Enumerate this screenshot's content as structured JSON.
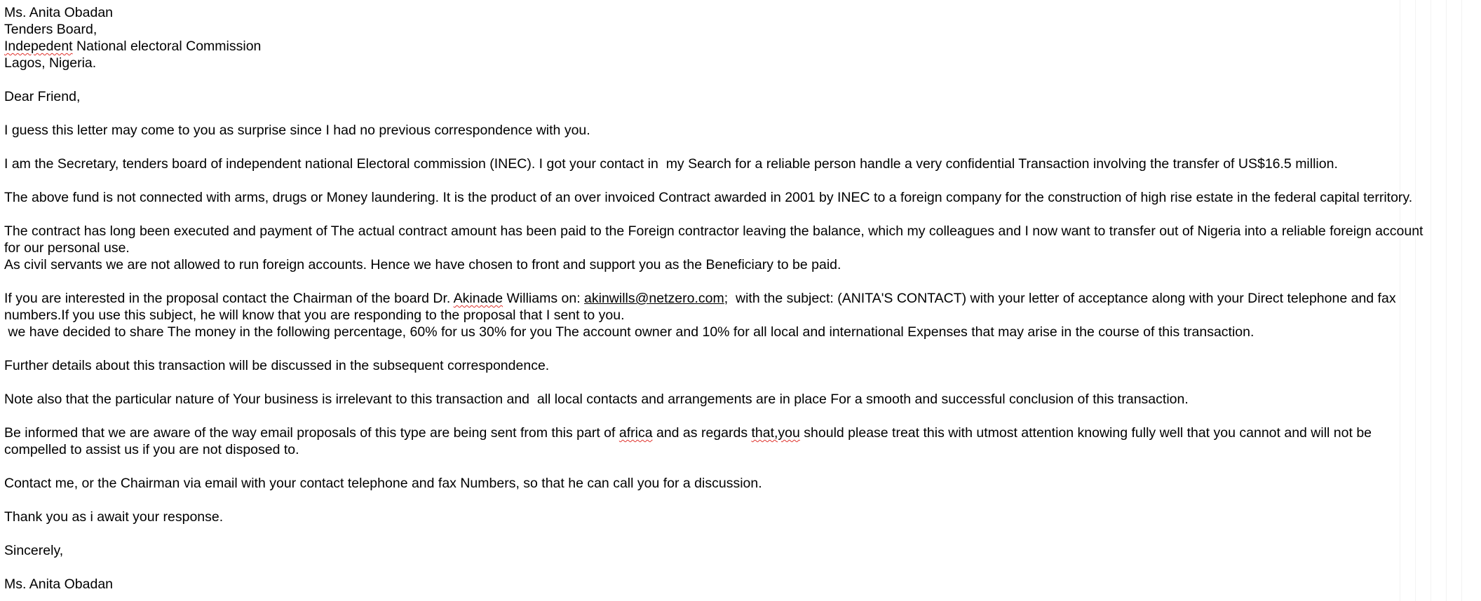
{
  "letter": {
    "address": {
      "name": "Ms. Anita Obadan",
      "board": "Tenders Board,",
      "org_misspelled": "Indepedent",
      "org_rest": " National electoral Commission",
      "city": "Lagos, Nigeria."
    },
    "greeting": "Dear Friend,",
    "p1": "I guess this letter may come to you as surprise since I had no previous correspondence with you.",
    "p2": "I am the Secretary, tenders board of independent national Electoral commission (INEC). I got your contact in  my Search for a reliable person handle a very confidential Transaction involving the transfer of US$16.5 million.",
    "p3": "The above fund is not connected with arms, drugs or Money laundering. It is the product of an over invoiced Contract awarded in 2001 by INEC to a foreign company for the construction of high rise estate in the federal capital territory.",
    "p4_line1": "The contract has long been executed and payment of The actual contract amount has been paid to the Foreign contractor leaving the balance, which my colleagues and I now want to transfer out of Nigeria into a reliable foreign account",
    "p4_line2": "for our personal use.",
    "p4_line3": "As civil servants we are not allowed to run foreign accounts. Hence we have chosen to front and support you as the Beneficiary to be paid.",
    "p5": {
      "before_name": "If you are interested in the proposal contact the Chairman of the board Dr. ",
      "name_misspelled": "Akinade",
      "after_name": " Williams on: ",
      "email": "akinwills@netzero.com",
      "after_email": ";  with the subject: (ANITA'S CONTACT) with your letter of acceptance along with your Direct telephone and fax",
      "line2": "numbers.If you use this subject, he will know that you are responding to the proposal that I sent to you.",
      "line3": " we have decided to share The money in the following percentage, 60% for us 30% for you The account owner and 10% for all local and international Expenses that may arise in the course of this transaction."
    },
    "p6": "Further details about this transaction will be discussed in the subsequent correspondence.",
    "p7": "Note also that the particular nature of Your business is irrelevant to this transaction and  all local contacts and arrangements are in place For a smooth and successful conclusion of this transaction.",
    "p8": {
      "before_africa": "Be informed that we are aware of the way email proposals of this type are being sent from this part of ",
      "africa": "africa",
      "middle": " and as regards ",
      "thatyou": "that,you",
      "after": " should please treat this with utmost attention knowing fully well that you cannot and will not be",
      "line2": "compelled to assist us if you are not disposed to."
    },
    "p9": "Contact me, or the Chairman via email with your contact telephone and fax Numbers, so that he can call you for a discussion.",
    "p10": "Thank you as i await your response.",
    "closing": "Sincerely,",
    "signature": "Ms. Anita Obadan"
  }
}
